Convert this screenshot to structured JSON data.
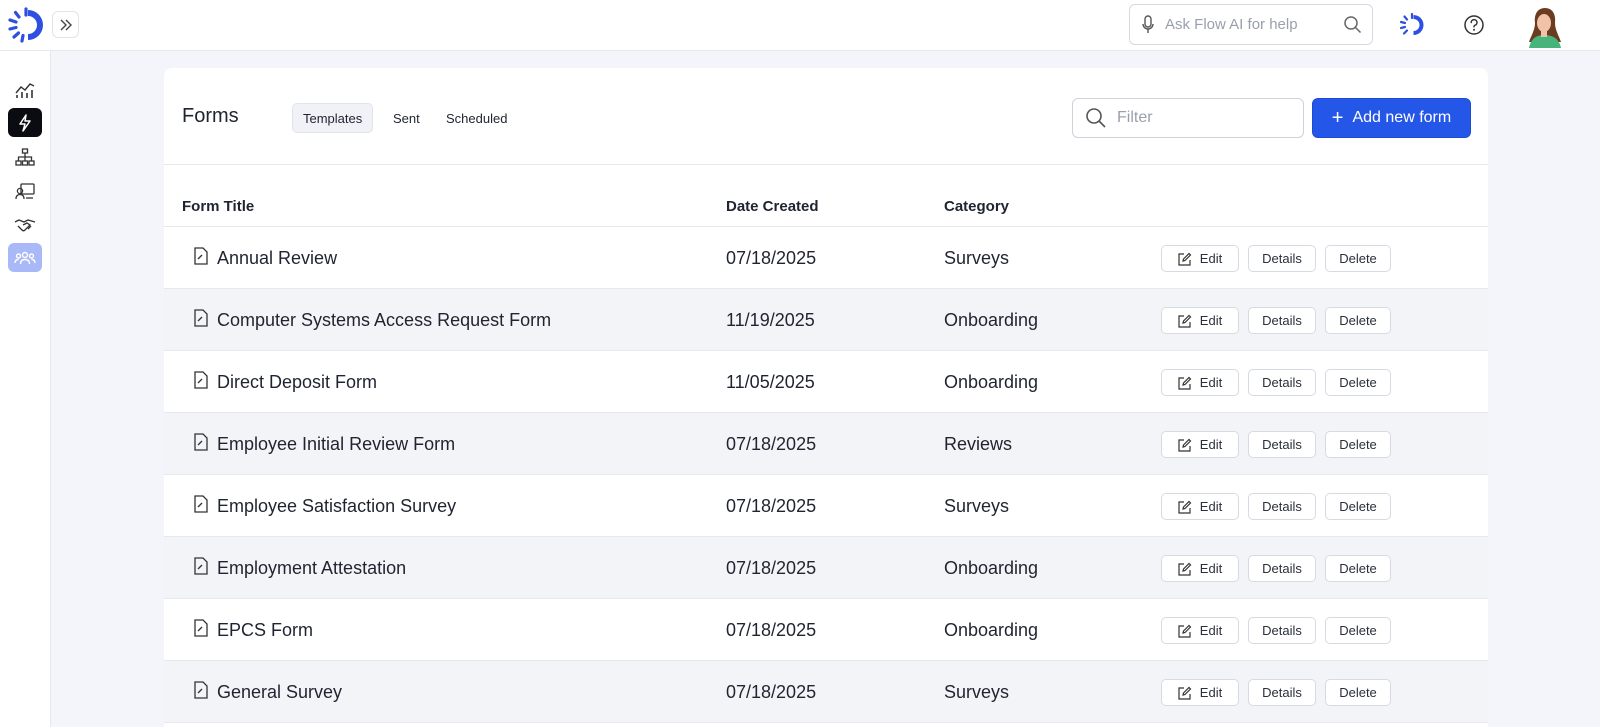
{
  "header": {
    "ai_placeholder": "Ask Flow AI for help",
    "icons": [
      "logo-icon",
      "expand-icon",
      "microphone-icon",
      "search-icon",
      "flow-ai-icon",
      "help-icon",
      "avatar"
    ]
  },
  "sidebar": {
    "items": [
      {
        "icon": "analytics-icon",
        "state": "default"
      },
      {
        "icon": "lightning-icon",
        "state": "active"
      },
      {
        "icon": "org-chart-icon",
        "state": "default"
      },
      {
        "icon": "id-card-icon",
        "state": "default"
      },
      {
        "icon": "handshake-icon",
        "state": "default"
      },
      {
        "icon": "team-icon",
        "state": "highlight"
      }
    ]
  },
  "page": {
    "title": "Forms",
    "tabs": [
      {
        "label": "Templates",
        "selected": true
      },
      {
        "label": "Sent",
        "selected": false
      },
      {
        "label": "Scheduled",
        "selected": false
      }
    ],
    "filter_placeholder": "Filter",
    "add_button_label": "Add new form"
  },
  "table": {
    "columns": [
      "Form Title",
      "Date Created",
      "Category"
    ],
    "action_labels": {
      "edit": "Edit",
      "details": "Details",
      "delete": "Delete"
    },
    "rows": [
      {
        "title": "Annual Review",
        "date": "07/18/2025",
        "category": "Surveys"
      },
      {
        "title": "Computer Systems Access Request Form",
        "date": "11/19/2025",
        "category": "Onboarding"
      },
      {
        "title": "Direct Deposit Form",
        "date": "11/05/2025",
        "category": "Onboarding"
      },
      {
        "title": "Employee Initial Review Form",
        "date": "07/18/2025",
        "category": "Reviews"
      },
      {
        "title": "Employee Satisfaction Survey",
        "date": "07/18/2025",
        "category": "Surveys"
      },
      {
        "title": "Employment Attestation",
        "date": "07/18/2025",
        "category": "Onboarding"
      },
      {
        "title": "EPCS Form",
        "date": "07/18/2025",
        "category": "Onboarding"
      },
      {
        "title": "General Survey",
        "date": "07/18/2025",
        "category": "Surveys"
      }
    ]
  },
  "colors": {
    "accent": "#2457e8",
    "active_nav": "#0b0b12",
    "highlight_nav": "#a9b9f7",
    "page_bg": "#f4f5fb",
    "alt_row": "#f3f4f7"
  }
}
